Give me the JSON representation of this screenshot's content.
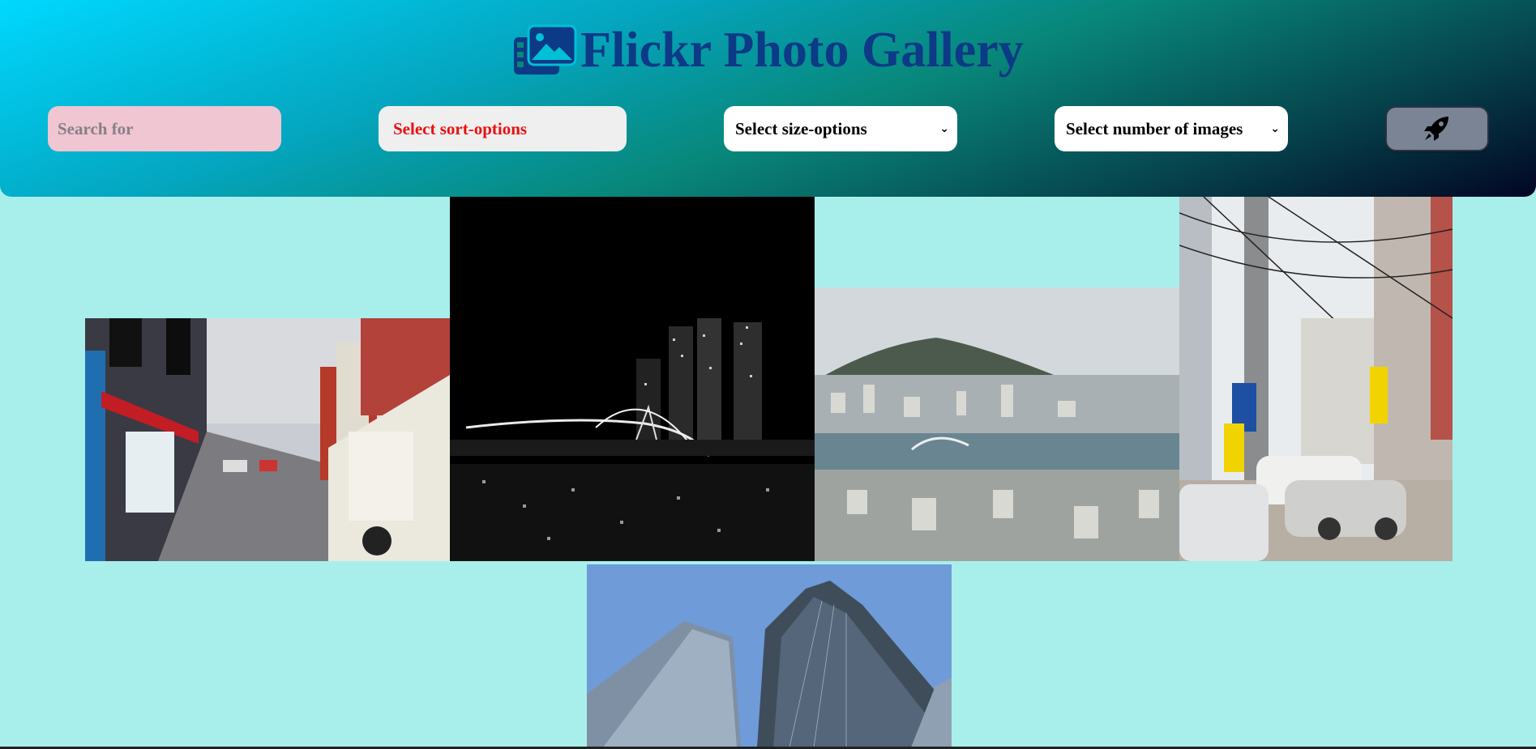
{
  "header": {
    "title": "Flickr Photo Gallery",
    "title_icon": "images-icon",
    "colors": {
      "title": "#0c3a86",
      "gradient_start": "#00d8ff",
      "gradient_end": "#020624"
    }
  },
  "controls": {
    "search_placeholder": "Search for",
    "sort_label": "Select sort-options",
    "size_label": "Select size-options",
    "count_label": "Select number of images",
    "submit_icon": "rocket-icon"
  },
  "gallery": {
    "background": "#a8efec",
    "photos": [
      {
        "subject": "street-with-signs"
      },
      {
        "subject": "night-bridge"
      },
      {
        "subject": "harbor-city-aerial"
      },
      {
        "subject": "market-street"
      },
      {
        "subject": "glass-towers"
      }
    ]
  }
}
